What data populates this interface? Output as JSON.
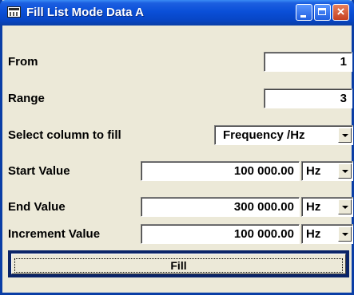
{
  "window": {
    "title": "Fill List Mode Data A"
  },
  "from": {
    "label": "From",
    "value": "1"
  },
  "range": {
    "label": "Range",
    "value": "3"
  },
  "column": {
    "label": "Select column to fill",
    "value": "Frequency /Hz"
  },
  "start": {
    "label": "Start Value",
    "value": "100 000.00",
    "unit": "Hz"
  },
  "end": {
    "label": "End Value",
    "value": "300 000.00",
    "unit": "Hz"
  },
  "increment": {
    "label": "Increment Value",
    "value": "100 000.00",
    "unit": "Hz"
  },
  "fill_button": {
    "label": "Fill"
  },
  "colors": {
    "titlebar": "#0a4fd8",
    "frame": "#0a3ea6",
    "background": "#ece9d8",
    "close": "#c64020"
  },
  "icons": [
    "app-icon",
    "minimize-icon",
    "maximize-icon",
    "close-icon",
    "chevron-down-icon"
  ]
}
